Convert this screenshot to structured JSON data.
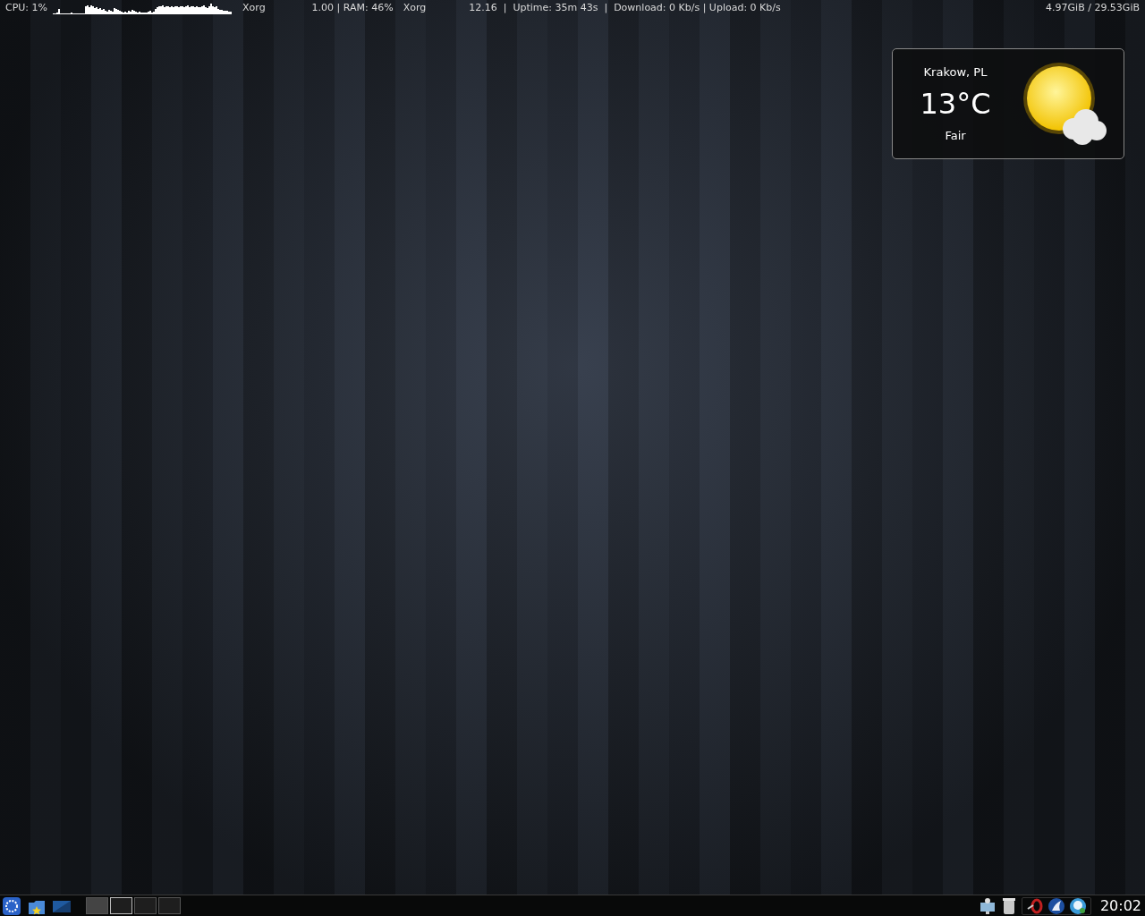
{
  "conky": {
    "cpu": "CPU: 1%",
    "process_1": "Xorg",
    "load_ram": "1.00 | RAM: 46%",
    "process_2": "Xorg",
    "stats": "12.16  |  Uptime: 35m 43s  |  Download: 0 Kb/s | Upload: 0 Kb/s",
    "disk": "4.97GiB / 29.53GiB"
  },
  "weather": {
    "location": "Krakow, PL",
    "temperature": "13°C",
    "condition": "Fair"
  },
  "taskbar": {
    "desktops": [
      {
        "selected": false,
        "occupied": true
      },
      {
        "selected": true,
        "occupied": false
      },
      {
        "selected": false,
        "occupied": false
      },
      {
        "selected": false,
        "occupied": false
      }
    ],
    "clock": "20:02"
  }
}
